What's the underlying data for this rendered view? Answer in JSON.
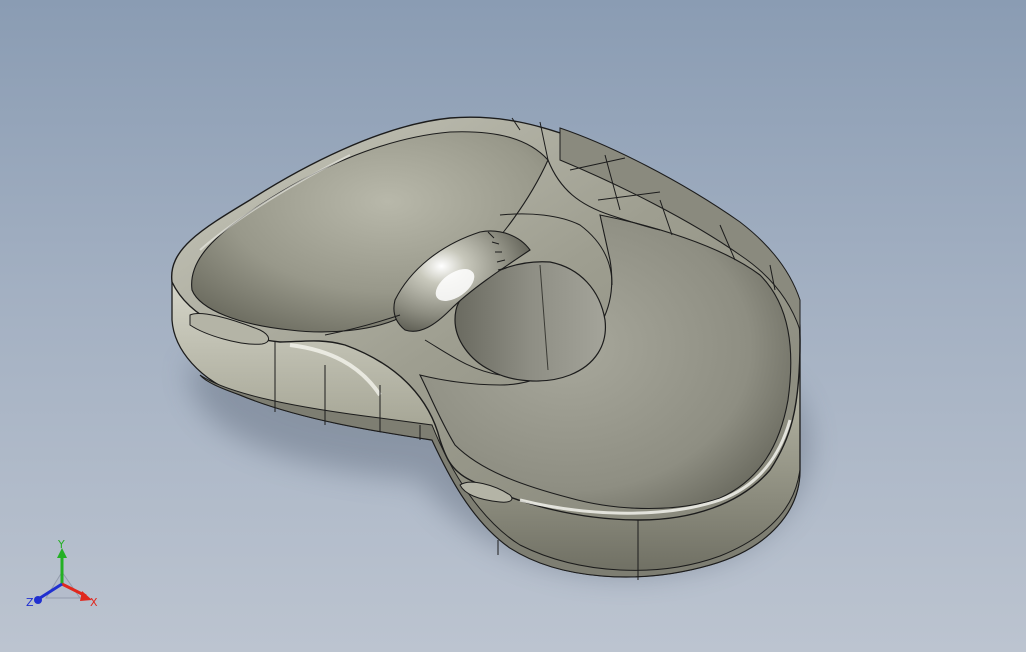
{
  "viewport": {
    "background_top": "#8a9cb3",
    "background_bottom": "#bcc4d0"
  },
  "model": {
    "body_color": "#a8a89a",
    "edge_color": "#1c1c1c"
  },
  "triad": {
    "x_label": "X",
    "y_label": "Y",
    "z_label": "Z",
    "x_color": "#e0281e",
    "y_color": "#24b024",
    "z_color": "#2030d0"
  }
}
